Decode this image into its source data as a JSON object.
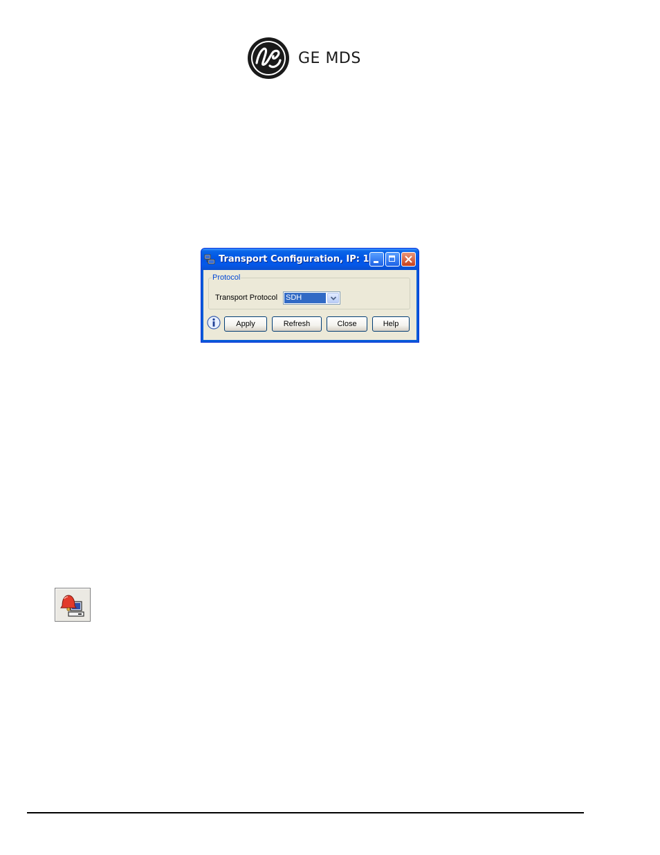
{
  "logo": {
    "text": "GE MDS",
    "icon": "ge-monogram-icon"
  },
  "dialog": {
    "title": "Transport Configuration, IP: 1...",
    "icon": "network-computer-icon",
    "title_buttons": [
      "minimize",
      "maximize",
      "close"
    ],
    "group_label": "Protocol",
    "field_label": "Transport Protocol",
    "field_value": "SDH",
    "buttons": {
      "apply": "Apply",
      "refresh": "Refresh",
      "close": "Close",
      "help": "Help"
    },
    "info_icon": "info-icon"
  },
  "toolbar_icon": "alarm-bell-computer-icon"
}
